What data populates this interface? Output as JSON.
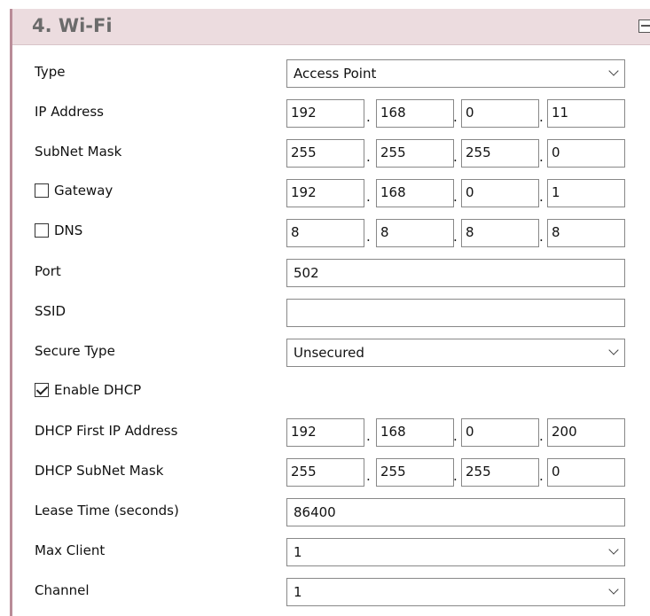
{
  "section": {
    "title": "4. Wi-Fi",
    "collapse_icon": "collapse-icon"
  },
  "rows": {
    "type": {
      "label": "Type",
      "value": "Access Point"
    },
    "ip_address": {
      "label": "IP Address",
      "octets": [
        "192",
        "168",
        "0",
        "11"
      ]
    },
    "subnet_mask": {
      "label": "SubNet Mask",
      "octets": [
        "255",
        "255",
        "255",
        "0"
      ]
    },
    "gateway": {
      "label": "Gateway",
      "checked": false,
      "octets": [
        "192",
        "168",
        "0",
        "1"
      ]
    },
    "dns": {
      "label": "DNS",
      "checked": false,
      "octets": [
        "8",
        "8",
        "8",
        "8"
      ]
    },
    "port": {
      "label": "Port",
      "value": "502"
    },
    "ssid": {
      "label": "SSID",
      "value": ""
    },
    "secure_type": {
      "label": "Secure Type",
      "value": "Unsecured"
    },
    "enable_dhcp": {
      "label": "Enable DHCP",
      "checked": true
    },
    "dhcp_first_ip": {
      "label": "DHCP First IP Address",
      "octets": [
        "192",
        "168",
        "0",
        "200"
      ]
    },
    "dhcp_subnet_mask": {
      "label": "DHCP SubNet Mask",
      "octets": [
        "255",
        "255",
        "255",
        "0"
      ]
    },
    "lease_time": {
      "label": "Lease Time (seconds)",
      "value": "86400"
    },
    "max_client": {
      "label": "Max Client",
      "value": "1"
    },
    "channel": {
      "label": "Channel",
      "value": "1"
    }
  },
  "ip_separator": "."
}
